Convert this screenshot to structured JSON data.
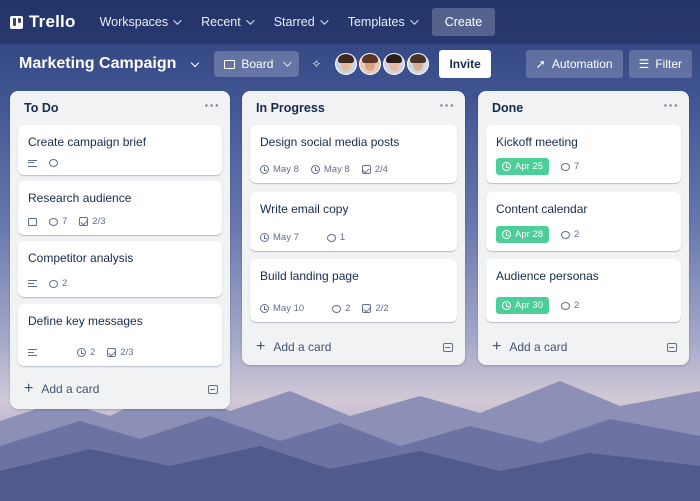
{
  "colors": {
    "nav_bg": "#1e2c5c",
    "list_bg": "#f1f2f4",
    "done_green": "#4bce97",
    "text": "#172b4d"
  },
  "nav": {
    "logo": "Trello",
    "items": [
      {
        "label": "Workspaces"
      },
      {
        "label": "Recent"
      },
      {
        "label": "Starred"
      },
      {
        "label": "Templates"
      }
    ],
    "create": "Create"
  },
  "board": {
    "title": "Marketing Campaign",
    "view": "Board",
    "invite": "Invite",
    "automation": "Automation",
    "filter": "Filter",
    "members": [
      "member-1",
      "member-2",
      "member-3",
      "member-4"
    ]
  },
  "lists": [
    {
      "title": "To Do",
      "add_label": "Add a card",
      "cards": [
        {
          "title": "Create campaign brief"
        },
        {
          "title": "Research audience",
          "comments": "7",
          "checklist": "2/3"
        },
        {
          "title": "Competitor analysis",
          "comments": "2"
        },
        {
          "title": "Define key messages",
          "comments": "2",
          "checklist": "2/3"
        }
      ]
    },
    {
      "title": "In Progress",
      "add_label": "Add a card",
      "cards": [
        {
          "title": "Design social media posts",
          "due": "May 8",
          "date2": "May 8",
          "checklist": "2/4"
        },
        {
          "title": "Write email copy",
          "due": "May 7",
          "comments": "1"
        },
        {
          "title": "Build landing page",
          "due": "May 10",
          "comments": "2",
          "checklist": "2/2"
        }
      ]
    },
    {
      "title": "Done",
      "add_label": "Add a card",
      "cards": [
        {
          "title": "Kickoff meeting",
          "due": "Apr 25",
          "comments": "7"
        },
        {
          "title": "Content calendar",
          "due": "Apr 28",
          "comments": "2"
        },
        {
          "title": "Audience personas",
          "due": "Apr 30",
          "comments": "2"
        }
      ]
    }
  ]
}
